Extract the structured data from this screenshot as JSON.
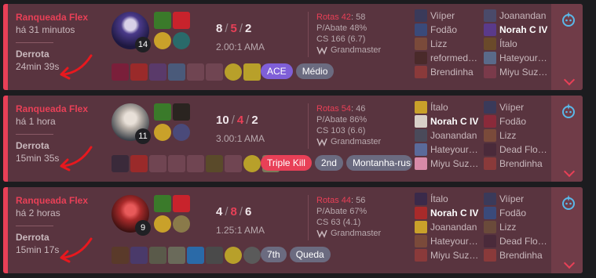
{
  "colors": {
    "loss": "#e84057",
    "card_bg": "#59343f",
    "expand_bg": "#703c48"
  },
  "matches": [
    {
      "queue": "Ranqueada Flex",
      "ago": "há 31 minutos",
      "result": "Derrota",
      "duration": "24min 39s",
      "level": "14",
      "kills": "8",
      "deaths": "5",
      "assists": "2",
      "ratio": "2.00:1 AMA",
      "kp_label": "Rotas 42",
      "kp_value": ": 58",
      "p_abate": "P/Abate 48%",
      "cs": "CS 166 (6.7)",
      "rank": "Grandmaster",
      "badges": [
        "ACE",
        "Médio"
      ],
      "blue": [
        "Viíper",
        "Fodão",
        "Lizz",
        "reformed…",
        "Brendinha"
      ],
      "red": [
        "Joanandan",
        "Norah C IV",
        "Ítalo",
        "Hateyour…",
        "Miyu Suz…"
      ]
    },
    {
      "queue": "Ranqueada Flex",
      "ago": "há 1 hora",
      "result": "Derrota",
      "duration": "15min 35s",
      "level": "11",
      "kills": "10",
      "deaths": "4",
      "assists": "2",
      "ratio": "3.00:1 AMA",
      "kp_label": "Rotas 54",
      "kp_value": ": 46",
      "p_abate": "P/Abate 86%",
      "cs": "CS 103 (6.6)",
      "rank": "Grandmaster",
      "badges": [
        "Triple Kill",
        "2nd",
        "Montanha-rus"
      ],
      "blue": [
        "Ítalo",
        "Norah C IV",
        "Joanandan",
        "Hateyour…",
        "Miyu Suz…"
      ],
      "red": [
        "Viíper",
        "Fodão",
        "Lizz",
        "Dead Flo…",
        "Brendinha"
      ]
    },
    {
      "queue": "Ranqueada Flex",
      "ago": "há 2 horas",
      "result": "Derrota",
      "duration": "15min 17s",
      "level": "9",
      "kills": "4",
      "deaths": "8",
      "assists": "6",
      "ratio": "1.25:1 AMA",
      "kp_label": "Rotas 44",
      "kp_value": ": 56",
      "p_abate": "P/Abate 67%",
      "cs": "CS 63 (4.1)",
      "rank": "Grandmaster",
      "badges": [
        "7th",
        "Queda"
      ],
      "blue": [
        "Ítalo",
        "Norah C IV",
        "Joanandan",
        "Hateyour…",
        "Miyu Suz…"
      ],
      "red": [
        "Viíper",
        "Fodão",
        "Lizz",
        "Dead Flo…",
        "Brendinha"
      ]
    }
  ]
}
